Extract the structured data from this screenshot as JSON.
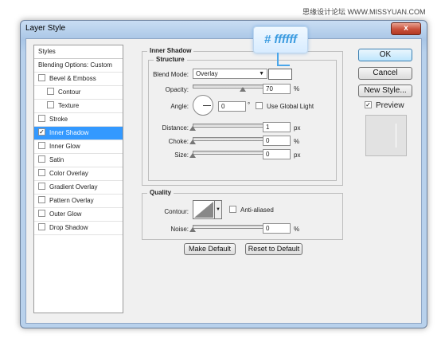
{
  "watermark": "思缘设计论坛 WWW.MISSYUAN.COM",
  "window": {
    "title": "Layer Style",
    "close_label": "x"
  },
  "callout": {
    "text": "# ffffff"
  },
  "styles_panel": {
    "header": "Styles",
    "items": [
      {
        "label": "Blending Options: Custom",
        "checkbox": false,
        "checked": false,
        "indent": false,
        "selected": false
      },
      {
        "label": "Bevel & Emboss",
        "checkbox": true,
        "checked": false,
        "indent": false,
        "selected": false
      },
      {
        "label": "Contour",
        "checkbox": true,
        "checked": false,
        "indent": true,
        "selected": false
      },
      {
        "label": "Texture",
        "checkbox": true,
        "checked": false,
        "indent": true,
        "selected": false
      },
      {
        "label": "Stroke",
        "checkbox": true,
        "checked": false,
        "indent": false,
        "selected": false
      },
      {
        "label": "Inner Shadow",
        "checkbox": true,
        "checked": true,
        "indent": false,
        "selected": true
      },
      {
        "label": "Inner Glow",
        "checkbox": true,
        "checked": false,
        "indent": false,
        "selected": false
      },
      {
        "label": "Satin",
        "checkbox": true,
        "checked": false,
        "indent": false,
        "selected": false
      },
      {
        "label": "Color Overlay",
        "checkbox": true,
        "checked": false,
        "indent": false,
        "selected": false
      },
      {
        "label": "Gradient Overlay",
        "checkbox": true,
        "checked": false,
        "indent": false,
        "selected": false
      },
      {
        "label": "Pattern Overlay",
        "checkbox": true,
        "checked": false,
        "indent": false,
        "selected": false
      },
      {
        "label": "Outer Glow",
        "checkbox": true,
        "checked": false,
        "indent": false,
        "selected": false
      },
      {
        "label": "Drop Shadow",
        "checkbox": true,
        "checked": false,
        "indent": false,
        "selected": false
      }
    ]
  },
  "inner_shadow": {
    "title": "Inner Shadow",
    "structure": {
      "title": "Structure",
      "blend_mode_label": "Blend Mode:",
      "blend_mode_value": "Overlay",
      "shadow_color": "#ffffff",
      "opacity_label": "Opacity:",
      "opacity_value": "70",
      "opacity_unit": "%",
      "opacity_fraction": 0.7,
      "angle_label": "Angle:",
      "angle_value": "0",
      "angle_unit": "°",
      "global_light_label": "Use Global Light",
      "distance_label": "Distance:",
      "distance_value": "1",
      "distance_unit": "px",
      "choke_label": "Choke:",
      "choke_value": "0",
      "choke_unit": "%",
      "size_label": "Size:",
      "size_value": "0",
      "size_unit": "px"
    },
    "quality": {
      "title": "Quality",
      "contour_label": "Contour:",
      "anti_aliased_label": "Anti-aliased",
      "noise_label": "Noise:",
      "noise_value": "0",
      "noise_unit": "%"
    },
    "make_default_label": "Make Default",
    "reset_default_label": "Reset to Default"
  },
  "buttons": {
    "ok": "OK",
    "cancel": "Cancel",
    "new_style": "New Style...",
    "preview_label": "Preview"
  }
}
